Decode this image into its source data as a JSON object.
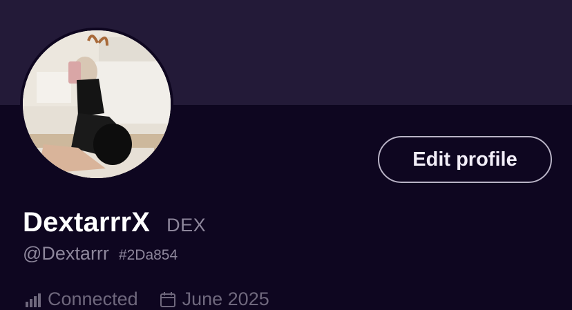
{
  "profile": {
    "display_name": "DextarrrX",
    "ticker": "DEX",
    "handle": "@Dextarrr",
    "tag": "#2Da854",
    "avatar_icon": "profile-photo"
  },
  "actions": {
    "edit_profile_label": "Edit profile"
  },
  "meta": {
    "status_icon": "signal-icon",
    "status_text": "Connected",
    "joined_icon": "calendar-icon",
    "joined_text": "June 2025"
  },
  "colors": {
    "banner": "#231a38",
    "background": "#0e0620",
    "muted_text": "#8d869b",
    "button_border": "#b9b3c6"
  }
}
